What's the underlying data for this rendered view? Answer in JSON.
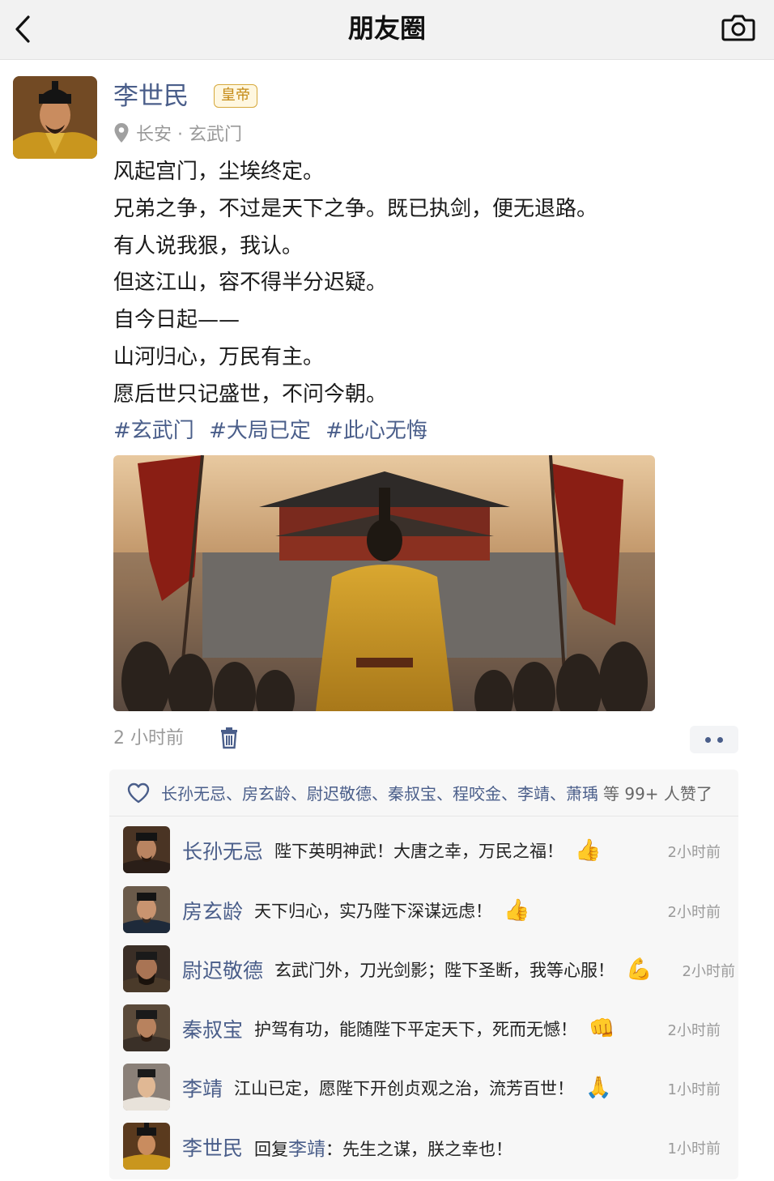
{
  "header": {
    "title": "朋友圈",
    "back_icon": "chevron-left-icon",
    "camera_icon": "camera-icon"
  },
  "post": {
    "author": "李世民",
    "badge": "皇帝",
    "location": "长安 · 玄武门",
    "lines": [
      "风起宫门，尘埃终定。",
      "兄弟之争，不过是天下之争。既已执剑，便无退路。",
      "有人说我狠，我认。",
      "但这江山，容不得半分迟疑。",
      "自今日起——",
      "山河归心，万民有主。",
      "愿后世只记盛世，不问今朝。"
    ],
    "hashtags": [
      "#玄武门",
      "#大局已定",
      "#此心无悔"
    ],
    "time": "2 小时前"
  },
  "likes": {
    "names": "长孙无忌、房玄龄、尉迟敬德、秦叔宝、程咬金、李靖、萧瑀",
    "suffix": "等 99+ 人赞了"
  },
  "comments": [
    {
      "name": "长孙无忌",
      "text": "陛下英明神武！大唐之幸，万民之福！",
      "emoji": "👍",
      "time": "2小时前"
    },
    {
      "name": "房玄龄",
      "text": "天下归心，实乃陛下深谋远虑！",
      "emoji": "👍",
      "time": "2小时前"
    },
    {
      "name": "尉迟敬德",
      "text": "玄武门外，刀光剑影；陛下圣断，我等心服！",
      "emoji": "💪",
      "time": "2小时前"
    },
    {
      "name": "秦叔宝",
      "text": "护驾有功，能随陛下平定天下，死而无憾！",
      "emoji": "👊",
      "time": "2小时前"
    },
    {
      "name": "李靖",
      "text": "江山已定，愿陛下开创贞观之治，流芳百世！",
      "emoji": "🙏",
      "time": "1小时前"
    },
    {
      "name": "李世民",
      "reply_label": "回复",
      "reply_to": "李靖",
      "text": "：先生之谋，朕之幸也！",
      "time": "1小时前"
    }
  ],
  "colors": {
    "link": "#4a5e8a",
    "badge": "#c48a14",
    "topbar": "#f2f2f2",
    "panel": "#f7f7f7"
  }
}
